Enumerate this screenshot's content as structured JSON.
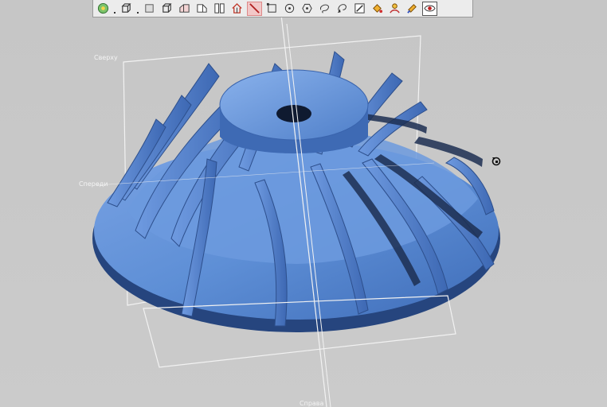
{
  "toolbar": {
    "buttons": [
      {
        "name": "view-all-icon"
      },
      {
        "name": "separator-dot"
      },
      {
        "name": "cube-view-icon"
      },
      {
        "name": "separator-dot"
      },
      {
        "name": "plane-view-icon"
      },
      {
        "name": "iso-cube-icon"
      },
      {
        "name": "section-left-icon"
      },
      {
        "name": "section-right-icon"
      },
      {
        "name": "split-view-icon"
      },
      {
        "name": "house-section-icon"
      },
      {
        "name": "line-tool-icon",
        "active": true
      },
      {
        "name": "rectangle-select-icon"
      },
      {
        "name": "circle-point-icon"
      },
      {
        "name": "hexagon-point-icon"
      },
      {
        "name": "lasso-icon"
      },
      {
        "name": "lasso-arrow-icon"
      },
      {
        "name": "edit-pen-icon"
      },
      {
        "name": "fill-bucket-icon"
      },
      {
        "name": "surface-tool-icon"
      },
      {
        "name": "paint-tool-icon"
      },
      {
        "name": "eye-visibility-icon",
        "selected": true
      }
    ]
  },
  "planes": {
    "top_label": "Сверху",
    "front_label": "Спереди",
    "side_label": "Справа"
  },
  "colors": {
    "model": "#5a8ad2",
    "background": "#c9c9c9",
    "active_tool": "#f2c7c7"
  }
}
